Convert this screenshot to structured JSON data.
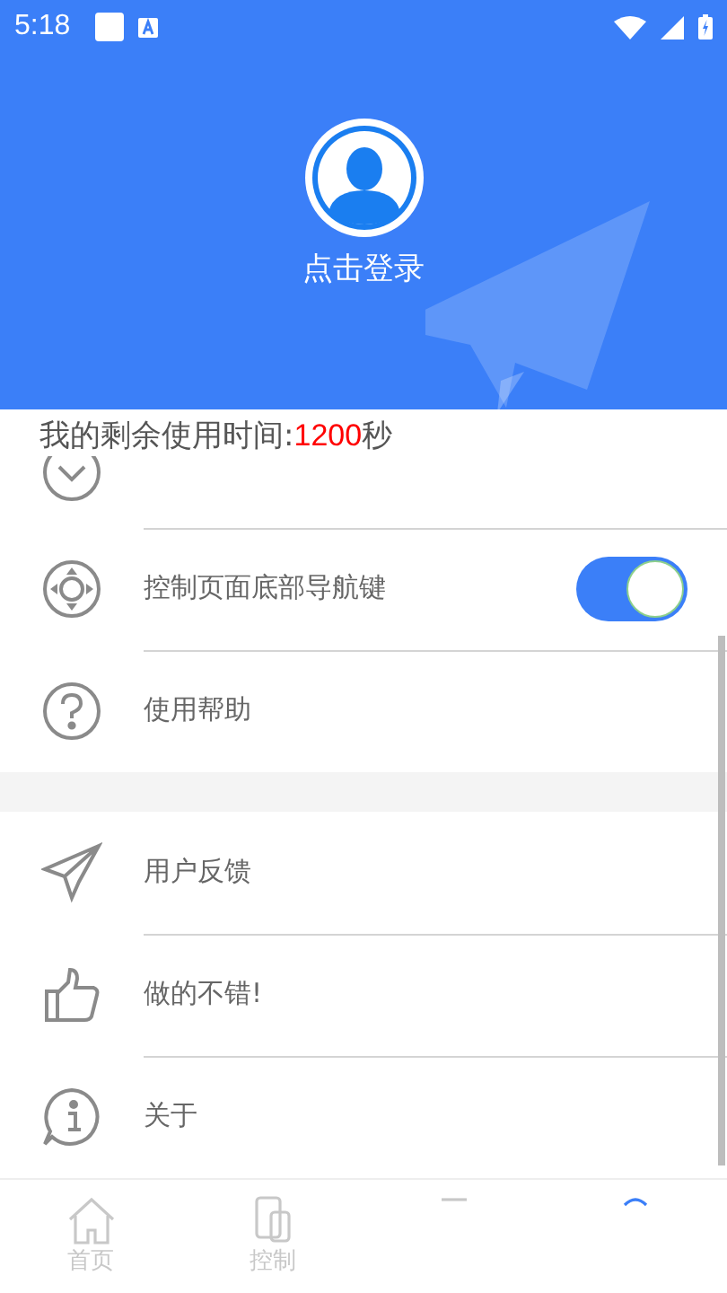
{
  "status_bar": {
    "time": "5:18"
  },
  "profile": {
    "login": "点击登录"
  },
  "remaining_time": {
    "prefix": "我的剩余使用时间:",
    "value": "1200",
    "unit": "秒"
  },
  "groups": [
    {
      "items": [
        {
          "kind": "hidden"
        },
        {
          "kind": "toggle",
          "label": "控制页面底部导航键",
          "on": true
        },
        {
          "kind": "link",
          "label": "使用帮助"
        }
      ]
    },
    {
      "items": [
        {
          "kind": "link",
          "label": "用户反馈"
        },
        {
          "kind": "link",
          "label": "做的不错!"
        },
        {
          "kind": "link",
          "label": "关于"
        }
      ]
    }
  ],
  "bottom_nav": [
    {
      "label": "首页",
      "selected": false
    },
    {
      "label": "控制",
      "selected": false
    },
    {
      "selected": false
    },
    {
      "selected": true
    }
  ]
}
